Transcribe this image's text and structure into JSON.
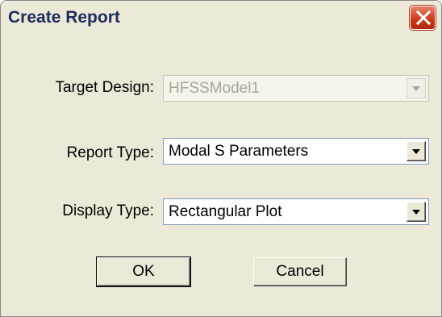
{
  "window": {
    "title": "Create Report"
  },
  "form": {
    "target_design": {
      "label": "Target Design:",
      "value": "HFSSModel1"
    },
    "report_type": {
      "label": "Report Type:",
      "value": "Modal S Parameters"
    },
    "display_type": {
      "label": "Display Type:",
      "value": "Rectangular Plot"
    }
  },
  "buttons": {
    "ok": "OK",
    "cancel": "Cancel"
  },
  "icons": {
    "close": "close-icon",
    "dropdown": "chevron-down-icon"
  },
  "colors": {
    "title_text": "#1f2c5e",
    "close_button": "#c9371a",
    "dialog_background": "#ece9d8"
  }
}
